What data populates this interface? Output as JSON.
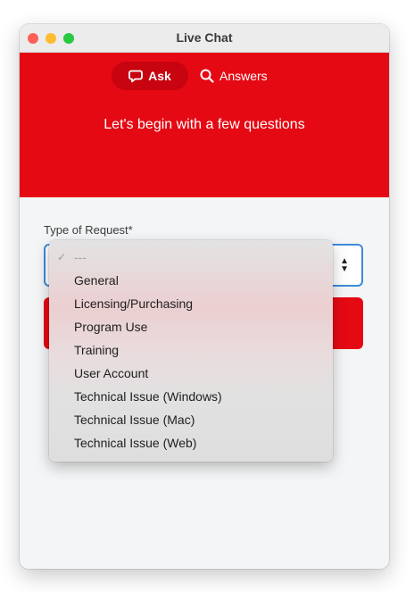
{
  "window": {
    "title": "Live Chat"
  },
  "tabs": {
    "ask_label": "Ask",
    "answers_label": "Answers"
  },
  "hero": {
    "heading": "Let's begin with a few questions"
  },
  "form": {
    "type_label": "Type of Request*",
    "selected_value": "---"
  },
  "dropdown": {
    "checkmark": "✓",
    "options": [
      "---",
      "General",
      "Licensing/Purchasing",
      "Program Use",
      "Training",
      "User Account",
      "Technical Issue (Windows)",
      "Technical Issue (Mac)",
      "Technical Issue (Web)"
    ]
  },
  "colors": {
    "brand_red": "#e50914",
    "active_tab": "#c7040f",
    "focus_border": "#3d8bd9"
  },
  "icons": {
    "ask": "chat-bubble-icon",
    "answers": "search-icon",
    "select": "chevron-up-down-icon"
  }
}
